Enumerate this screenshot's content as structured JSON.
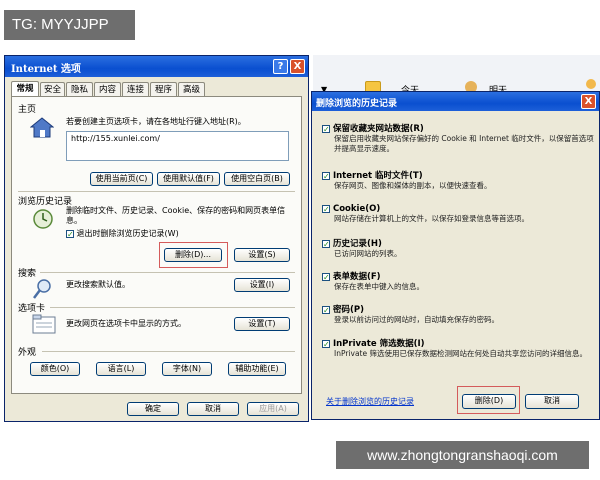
{
  "overlay": {
    "tg": "TG: MYYJJPP",
    "watermark": "www.zhongtongranshaoqi.com"
  },
  "internet_options": {
    "title": "Internet 选项",
    "help_label": "?",
    "close_label": "X",
    "tabs": [
      "常规",
      "安全",
      "隐私",
      "内容",
      "连接",
      "程序",
      "高级"
    ],
    "homepage": {
      "section": "主页",
      "desc": "若要创建主页选项卡，请在各地址行键入地址(R)。",
      "url": "http://155.xunlei.com/",
      "buttons": [
        "使用当前页(C)",
        "使用默认值(F)",
        "使用空白页(B)"
      ]
    },
    "history": {
      "section": "浏览历史记录",
      "desc": "删除临时文件、历史记录、Cookie、保存的密码和网页表单信息。",
      "checkbox": "退出时删除浏览历史记录(W)",
      "delete_btn": "删除(D)...",
      "settings_btn": "设置(S)"
    },
    "search": {
      "section": "搜索",
      "desc": "更改搜索默认值。",
      "settings_btn": "设置(I)"
    },
    "tabsec": {
      "section": "选项卡",
      "desc": "更改网页在选项卡中显示的方式。",
      "settings_btn": "设置(T)"
    },
    "appearance": {
      "section": "外观",
      "buttons": [
        "颜色(O)",
        "语言(L)",
        "字体(N)",
        "辅助功能(E)"
      ]
    },
    "footer": {
      "ok": "确定",
      "cancel": "取消",
      "apply": "应用(A)"
    }
  },
  "browser_bg": {
    "today": "今天",
    "tomorrow": "明天"
  },
  "delete_history": {
    "title": "删除浏览的历史记录",
    "items": [
      {
        "label": "保留收藏夹网站数据(R)",
        "desc": "保留启用收藏夹网站保存偏好的 Cookie 和 Internet 临时文件，以保留首选项并提高显示速度。"
      },
      {
        "label": "Internet 临时文件(T)",
        "desc": "保存网页、图像和媒体的副本，以便快速查看。"
      },
      {
        "label": "Cookie(O)",
        "desc": "网站存储在计算机上的文件，以保存如登录信息等首选项。"
      },
      {
        "label": "历史记录(H)",
        "desc": "已访问网站的列表。"
      },
      {
        "label": "表单数据(F)",
        "desc": "保存在表单中键入的信息。"
      },
      {
        "label": "密码(P)",
        "desc": "登录以前访问过的网站时，自动填充保存的密码。"
      },
      {
        "label": "InPrivate 筛选数据(I)",
        "desc": "InPrivate 筛选使用已保存数据检测网站在何处自动共享您访问的详细信息。"
      }
    ],
    "link": "关于删除浏览的历史记录",
    "delete_btn": "删除(D)",
    "cancel_btn": "取消"
  }
}
